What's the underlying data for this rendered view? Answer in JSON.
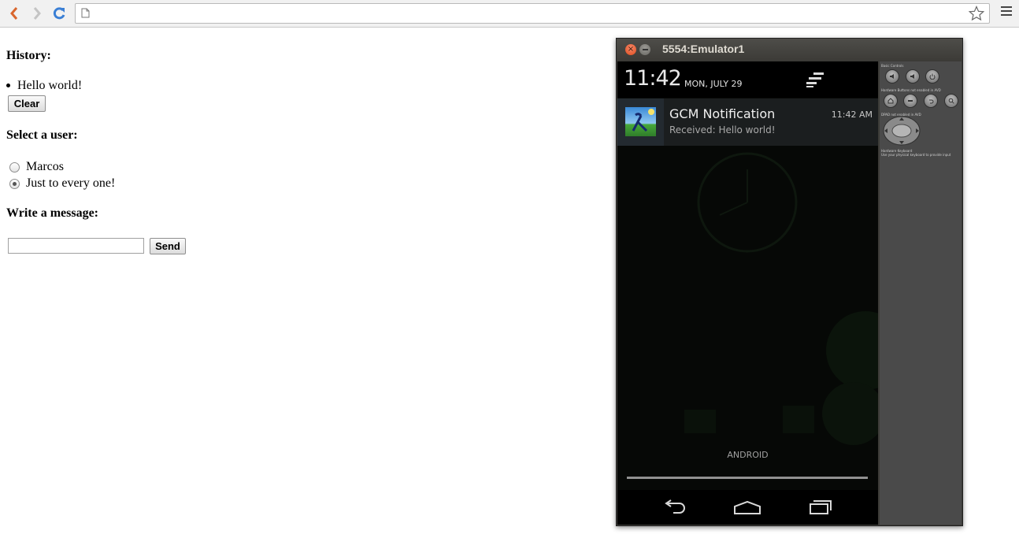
{
  "browser": {
    "address": "",
    "icons": [
      "back-icon",
      "forward-icon",
      "reload-icon",
      "page-icon",
      "star-icon",
      "menu-icon"
    ]
  },
  "page": {
    "history_title": "History:",
    "history_items": [
      "Hello world!"
    ],
    "clear_label": "Clear",
    "user_title": "Select a user:",
    "users": [
      {
        "label": "Marcos",
        "checked": false
      },
      {
        "label": "Just to every one!",
        "checked": true
      }
    ],
    "message_title": "Write a message:",
    "message_value": "",
    "send_label": "Send"
  },
  "emulator": {
    "title": "5554:Emulator1",
    "clock": "11:42",
    "date": "MON, JULY 29",
    "notification": {
      "title": "GCM Notification",
      "text": "Received: Hello world!",
      "time": "11:42 AM"
    },
    "carrier": "ANDROID",
    "controls": {
      "basic": "Basic Controls",
      "hardware": "Hardware Buttons",
      "hardware_note": "not enabled in AVD",
      "dpad": "DPAD",
      "dpad_note": "not enabled in AVD",
      "keyboard": "Hardware Keyboard",
      "keyboard_note": "Use your physical keyboard to provide input"
    }
  },
  "colors": {
    "close": "#dd4b1d",
    "toolbar": "#f1f1f1",
    "reload": "#3a7fd5"
  }
}
